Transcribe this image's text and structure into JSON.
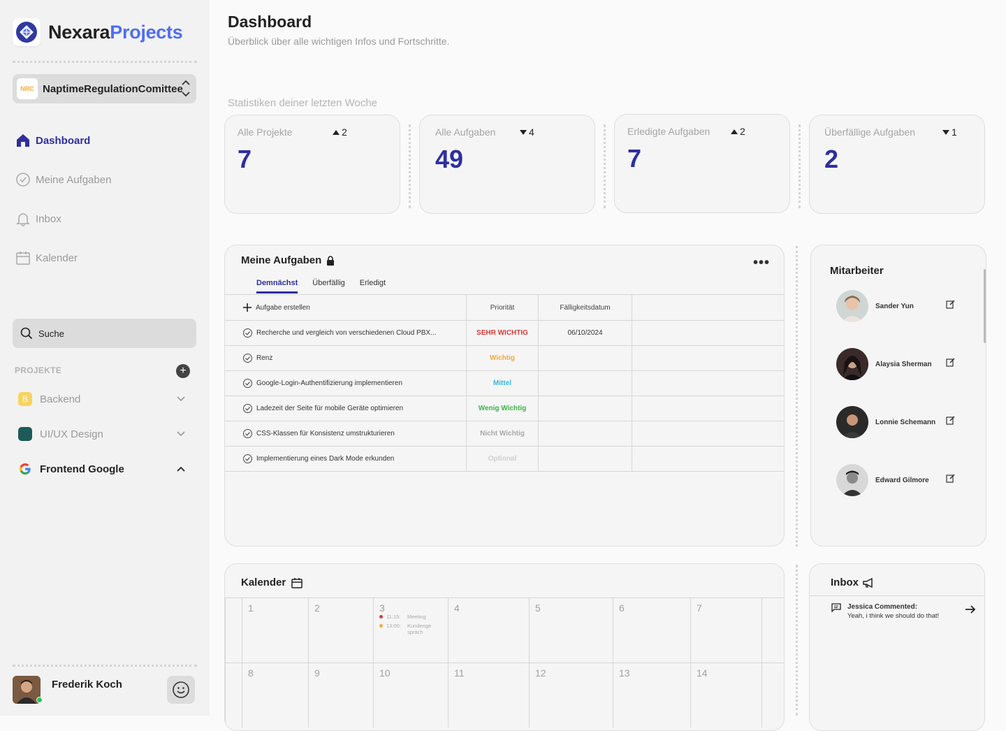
{
  "app": {
    "name_part1": "Nexara",
    "name_part2": "Projects"
  },
  "team": {
    "logo_text": "NRC",
    "name": "NaptimeRegulationComittee"
  },
  "nav": [
    {
      "label": "Dashboard",
      "icon": "home-icon"
    },
    {
      "label": "Meine Aufgaben",
      "icon": "check-circle-icon"
    },
    {
      "label": "Inbox",
      "icon": "bell-icon"
    },
    {
      "label": "Kalender",
      "icon": "calendar-icon"
    }
  ],
  "search": {
    "label": "Suche"
  },
  "projects": {
    "header": "PROJEKTE",
    "items": [
      {
        "label": "Backend",
        "badge": "B",
        "color": "#f8d35e"
      },
      {
        "label": "UI/UX Design",
        "badge": "",
        "color": "#1f5a5a"
      },
      {
        "label": "Frontend Google",
        "badge": "G",
        "color": "#ffffff"
      }
    ]
  },
  "user": {
    "name": "Frederik Koch",
    "status": "online"
  },
  "page": {
    "title": "Dashboard",
    "subtitle": "Überblick über alle wichtigen Infos und Fortschritte.",
    "stats_title": "Statistiken deiner letzten Woche"
  },
  "stats": [
    {
      "label": "Alle Projekte",
      "delta": "2",
      "direction": "up",
      "value": "7"
    },
    {
      "label": "Alle Aufgaben",
      "delta": "4",
      "direction": "down",
      "value": "49"
    },
    {
      "label": "Erledigte Aufgaben",
      "delta": "2",
      "direction": "up",
      "value": "7"
    },
    {
      "label": "Überfällige Aufgaben",
      "delta": "1",
      "direction": "down",
      "value": "2"
    }
  ],
  "tasks": {
    "title": "Meine Aufgaben",
    "tabs": [
      "Demnächst",
      "Überfällig",
      "Erledigt"
    ],
    "active_tab": "Demnächst",
    "create_label": "Aufgabe erstellen",
    "columns": [
      "Priorität",
      "Fälligkeitsdatum"
    ],
    "rows": [
      {
        "title": "Recherche und vergleich von verschiedenen Cloud PBX...",
        "priority": "SEHR WICHTIG",
        "priority_color": "#d63b3b",
        "due": "06/10/2024"
      },
      {
        "title": "Renz",
        "priority": "Wichtig",
        "priority_color": "#f2a93b",
        "due": ""
      },
      {
        "title": "Google-Login-Authentifizierung implementieren",
        "priority": "Mittel",
        "priority_color": "#3bb6d6",
        "due": ""
      },
      {
        "title": "Ladezeit der Seite für mobile Geräte optimieren",
        "priority": "Wenig Wichtig",
        "priority_color": "#3bb34a",
        "due": ""
      },
      {
        "title": "CSS-Klassen für Konsistenz umstrukturieren",
        "priority": "Nicht Wichtig",
        "priority_color": "#a8a8a8",
        "due": ""
      },
      {
        "title": "Implementierung eines Dark Mode erkunden",
        "priority": "Optional",
        "priority_color": "#cfcfcf",
        "due": ""
      }
    ]
  },
  "members": {
    "title": "Mitarbeiter",
    "items": [
      {
        "name": "Sander Yun"
      },
      {
        "name": "Alaysia Sherman"
      },
      {
        "name": "Lonnie Schemann"
      },
      {
        "name": "Edward Gilmore"
      }
    ]
  },
  "calendar": {
    "title": "Kalender",
    "week1": [
      "1",
      "2",
      "3",
      "4",
      "5",
      "6",
      "7"
    ],
    "week2": [
      "8",
      "9",
      "10",
      "11",
      "12",
      "13",
      "14"
    ],
    "events": [
      {
        "time": "11:15:",
        "title": "Meeting",
        "color": "#d63b3b"
      },
      {
        "time": "13:00:",
        "title": "Kundenge spräch",
        "color": "#f2a93b"
      }
    ]
  },
  "inbox": {
    "title": "Inbox",
    "message": {
      "author": "Jessica Commented:",
      "text": "Yeah, i think we should do that!"
    }
  }
}
